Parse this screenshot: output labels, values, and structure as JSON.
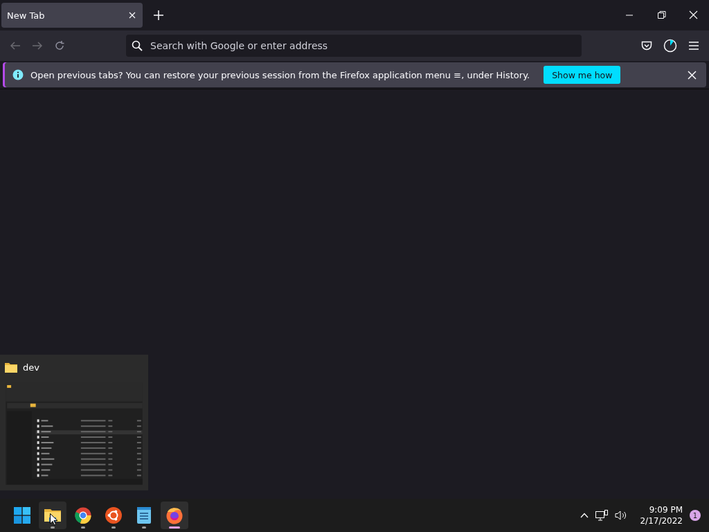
{
  "tabs": [
    {
      "label": "New Tab",
      "selected": true
    }
  ],
  "toolbar": {
    "back_disabled": true,
    "forward_disabled": true,
    "address": {
      "placeholder": "Search with Google or enter address"
    }
  },
  "notification": {
    "message": "Open previous tabs? You can restore your previous session from the Firefox application menu ≡, under History.",
    "button": "Show me how"
  },
  "preview": {
    "title": "dev"
  },
  "taskbar": {
    "apps": [
      {
        "kind": "start",
        "running": false,
        "active": false,
        "hovered": false
      },
      {
        "kind": "files",
        "running": true,
        "active": false,
        "hovered": true
      },
      {
        "kind": "chrome",
        "running": true,
        "active": false,
        "hovered": false
      },
      {
        "kind": "ubuntu",
        "running": true,
        "active": false,
        "hovered": false
      },
      {
        "kind": "notepad",
        "running": true,
        "active": false,
        "hovered": false
      },
      {
        "kind": "firefox",
        "running": true,
        "active": true,
        "hovered": false
      }
    ],
    "time": "9:09 PM",
    "date": "2/17/2022",
    "notifications": "1"
  }
}
